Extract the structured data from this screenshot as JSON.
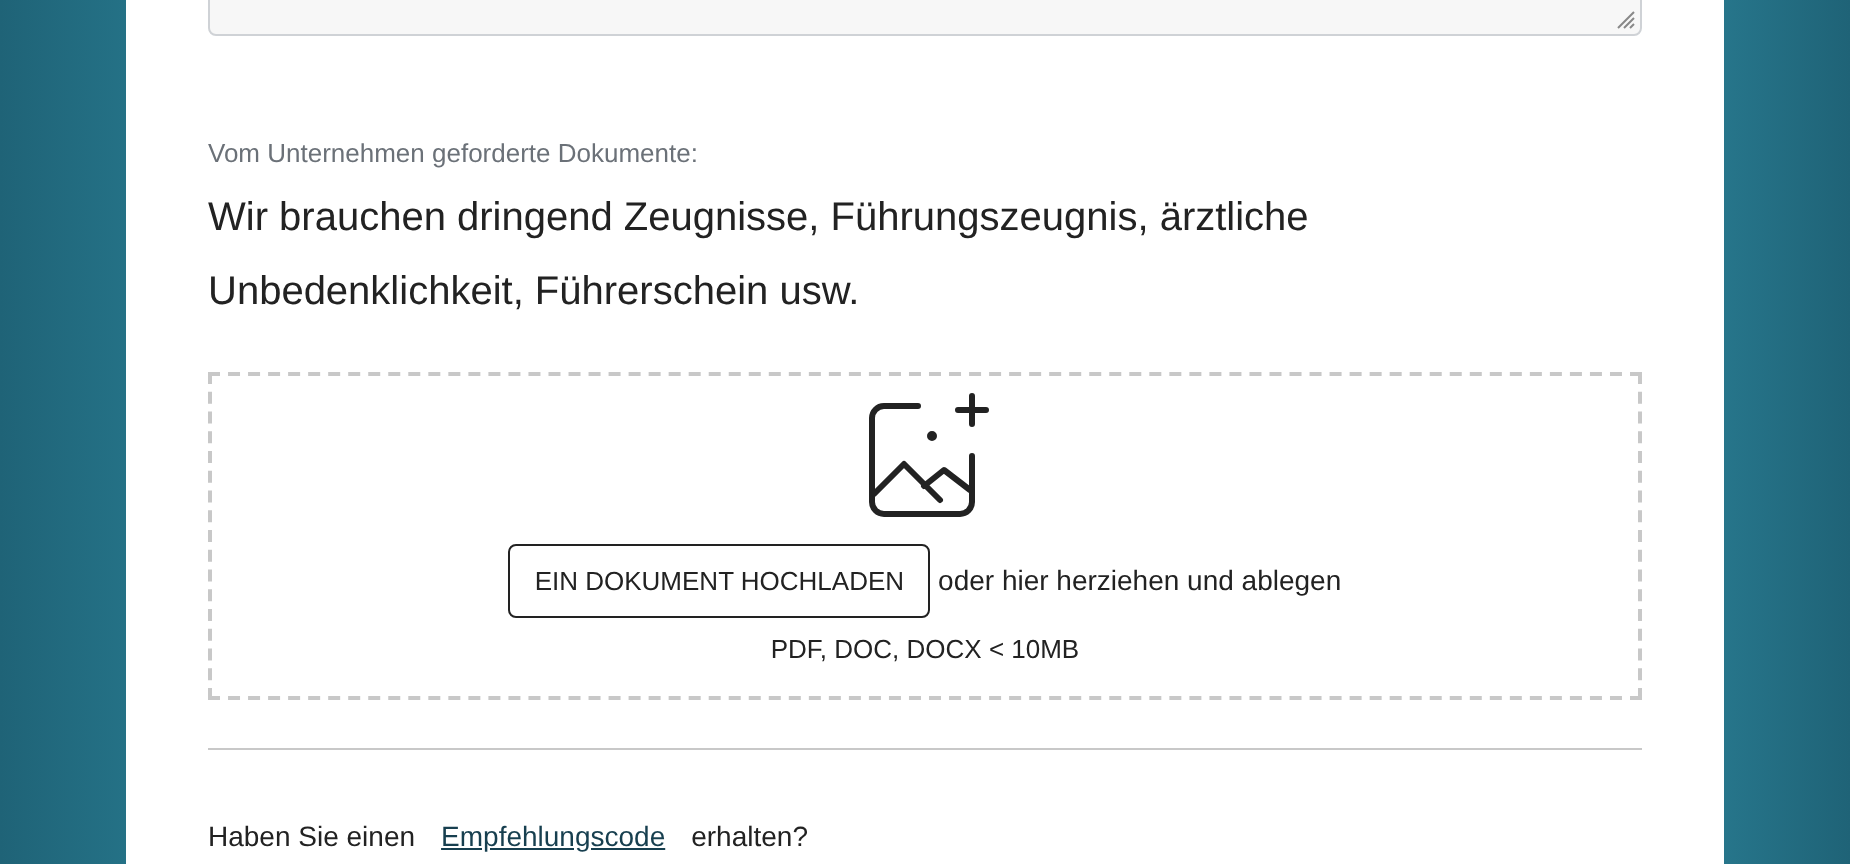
{
  "documents": {
    "label": "Vom Unternehmen geforderte Dokumente:",
    "text": "Wir brauchen dringend Zeugnisse, Führungszeugnis, ärztliche Unbedenklichkeit, Führerschein usw."
  },
  "upload": {
    "button": "EIN DOKUMENT HOCHLADEN",
    "hint": "oder hier herziehen und ablegen",
    "formats": "PDF, DOC, DOCX < 10MB"
  },
  "referral": {
    "before": "Haben Sie einen",
    "link": "Empfehlungscode",
    "after": "erhalten?"
  }
}
